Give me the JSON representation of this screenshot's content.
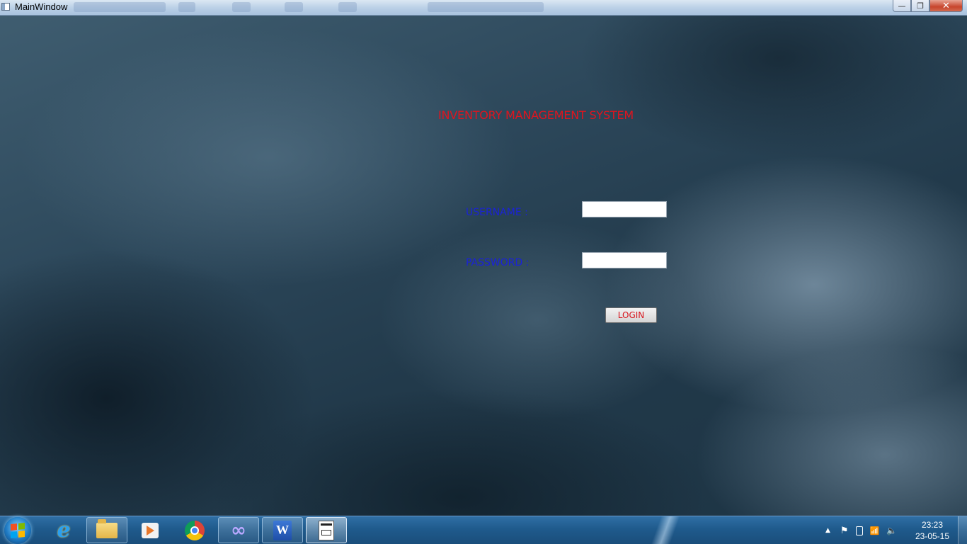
{
  "window": {
    "title": "MainWindow",
    "minimize_label": "—",
    "maximize_label": "❐",
    "close_label": "✕"
  },
  "main": {
    "app_title": "INVENTORY MANAGEMENT SYSTEM",
    "username_label": "USERNAME  :",
    "username_value": "",
    "password_label": "PASSWORD  :",
    "password_value": "",
    "login_label": "LOGIN",
    "colors": {
      "title": "#e0141e",
      "labels": "#1a22d8",
      "button_text": "#d8141c"
    }
  },
  "taskbar": {
    "items": [
      {
        "icon": "internet-explorer-icon",
        "glyph": "e"
      },
      {
        "icon": "windows-explorer-icon"
      },
      {
        "icon": "media-player-icon"
      },
      {
        "icon": "chrome-icon"
      },
      {
        "icon": "visual-studio-icon",
        "glyph": "∞"
      },
      {
        "icon": "word-icon",
        "glyph": "W"
      },
      {
        "icon": "application-window-icon"
      }
    ],
    "tray": {
      "show_hidden_glyph": "▲",
      "flag_glyph": "⚑",
      "network_glyph": "📶",
      "volume_glyph": "🔈"
    },
    "clock": {
      "time": "23:23",
      "date": "23-05-15"
    }
  }
}
